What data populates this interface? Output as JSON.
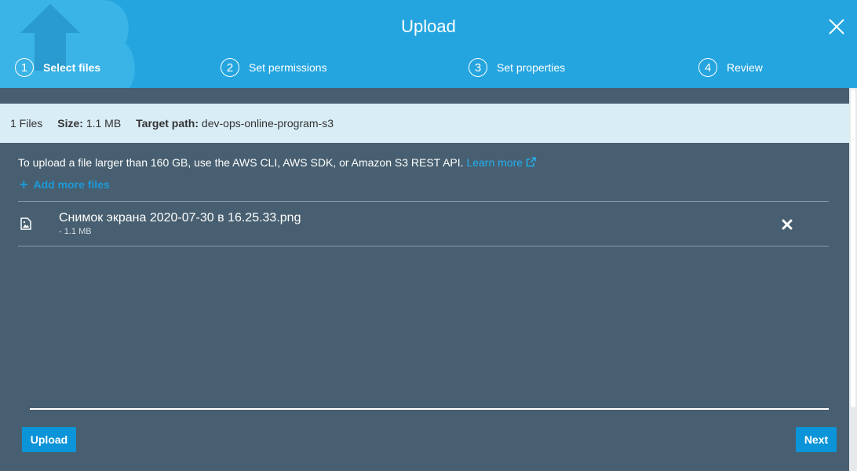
{
  "header": {
    "title": "Upload",
    "steps": [
      {
        "number": "1",
        "label": "Select files",
        "active": true
      },
      {
        "number": "2",
        "label": "Set permissions",
        "active": false
      },
      {
        "number": "3",
        "label": "Set properties",
        "active": false
      },
      {
        "number": "4",
        "label": "Review",
        "active": false
      }
    ]
  },
  "summary": {
    "files": "1 Files",
    "size_label": "Size:",
    "size_value": "1.1 MB",
    "target_label": "Target path:",
    "target_value": "dev-ops-online-program-s3"
  },
  "info": {
    "text": "To upload a file larger than 160 GB, use the AWS CLI, AWS SDK, or Amazon S3 REST API.",
    "link": "Learn more"
  },
  "add_more": {
    "plus": "+",
    "label": "Add more files"
  },
  "files": [
    {
      "name": "Снимок экрана 2020-07-30 в 16.25.33.png",
      "size": "- 1.1 MB"
    }
  ],
  "footer": {
    "upload_label": "Upload",
    "next_label": "Next"
  },
  "colors": {
    "header": "#24a5df",
    "body": "#475f70",
    "summary": "#d9edf7",
    "button": "#0b94d8",
    "link": "#26b0f0"
  },
  "icons": {
    "close": "close-icon",
    "external": "external-link-icon",
    "file": "image-file-icon",
    "remove": "remove-icon"
  }
}
